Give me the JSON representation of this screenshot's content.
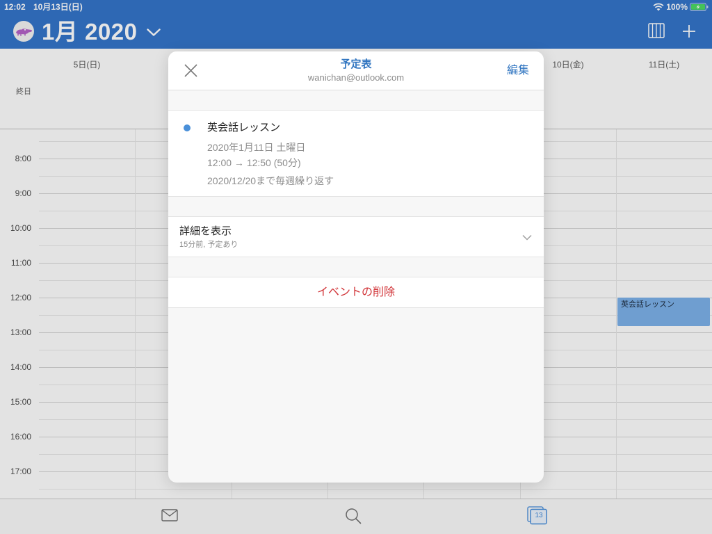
{
  "status_bar": {
    "time": "12:02",
    "date": "10月13日(日)",
    "battery_text": "100%",
    "icons": {
      "wifi": "wifi-icon",
      "battery": "battery-charging-icon"
    }
  },
  "header": {
    "month_title": "1月 2020",
    "icons": {
      "avatar": "crocodile-avatar-icon",
      "month_picker": "chevron-down-icon",
      "view_switch": "week-view-columns-icon",
      "add_event": "plus-icon"
    }
  },
  "calendar": {
    "all_day_label": "終日",
    "day_headers": [
      "5日(日)",
      "10日(金)",
      "11日(土)"
    ],
    "hour_labels": [
      "8:00",
      "9:00",
      "10:00",
      "11:00",
      "12:00",
      "13:00",
      "14:00",
      "15:00",
      "16:00",
      "17:00"
    ],
    "events": [
      {
        "title": "英会話レッスン"
      }
    ]
  },
  "tab_bar": {
    "calendar_day": "13",
    "icons": {
      "mail": "mail-icon",
      "search": "search-icon",
      "calendar": "calendar-icon"
    }
  },
  "event_modal": {
    "title": "予定表",
    "account": "wanichan@outlook.com",
    "edit_label": "編集",
    "icons": {
      "close": "close-icon",
      "details_toggle": "chevron-down-icon"
    },
    "event": {
      "title": "英会話レッスン",
      "date": "2020年1月11日 土曜日",
      "time": "12:00 → 12:50 (50分)",
      "recurrence": "2020/12/20まで毎週繰り返す"
    },
    "details": {
      "label": "詳細を表示",
      "summary": "15分前, 予定あり"
    },
    "delete_label": "イベントの削除"
  },
  "colors": {
    "brand_blue": "#3474c9",
    "accent_blue": "#2f74c0",
    "event_blue": "#7cb0e8",
    "event_dot": "#4a90d9",
    "delete_red": "#d13438",
    "calendar_tab_blue": "#4189d9"
  }
}
